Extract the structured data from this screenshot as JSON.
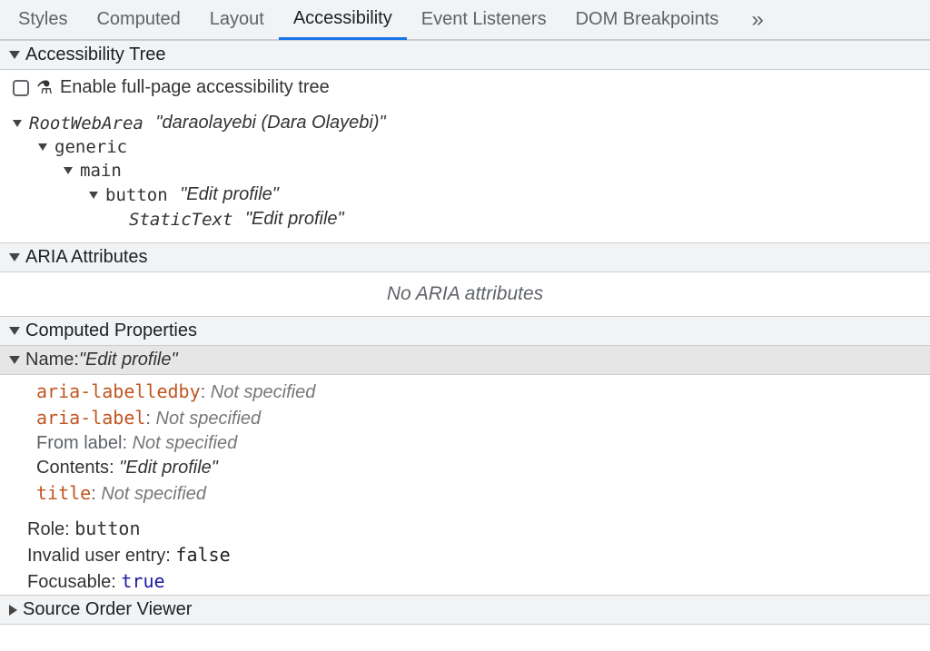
{
  "tabs": {
    "styles": "Styles",
    "computed": "Computed",
    "layout": "Layout",
    "accessibility": "Accessibility",
    "eventListeners": "Event Listeners",
    "domBreakpoints": "DOM Breakpoints",
    "overflow": "»"
  },
  "sections": {
    "accessibilityTree": "Accessibility Tree",
    "ariaAttributes": "ARIA Attributes",
    "computedProperties": "Computed Properties",
    "sourceOrderViewer": "Source Order Viewer"
  },
  "enable": {
    "label": "Enable full-page accessibility tree"
  },
  "tree": {
    "root": {
      "role": "RootWebArea",
      "name": "\"daraolayebi (Dara Olayebi)\""
    },
    "generic": "generic",
    "main": "main",
    "button": {
      "role": "button",
      "name": "\"Edit profile\""
    },
    "staticText": {
      "role": "StaticText",
      "name": "\"Edit profile\""
    }
  },
  "aria": {
    "empty": "No ARIA attributes"
  },
  "computed": {
    "nameHeader": {
      "label": "Name: ",
      "value": "\"Edit profile\""
    },
    "ariaLabelledby": {
      "key": "aria-labelledby",
      "sep": ": ",
      "val": "Not specified"
    },
    "ariaLabel": {
      "key": "aria-label",
      "sep": ": ",
      "val": "Not specified"
    },
    "fromLabel": {
      "key": "From label",
      "sep": ": ",
      "val": "Not specified"
    },
    "contents": {
      "key": "Contents",
      "sep": ": ",
      "val": "\"Edit profile\""
    },
    "title": {
      "key": "title",
      "sep": ": ",
      "val": "Not specified"
    },
    "role": {
      "key": "Role",
      "sep": ": ",
      "val": "button"
    },
    "invalid": {
      "key": "Invalid user entry",
      "sep": ": ",
      "val": "false"
    },
    "focusable": {
      "key": "Focusable",
      "sep": ": ",
      "val": "true"
    }
  }
}
